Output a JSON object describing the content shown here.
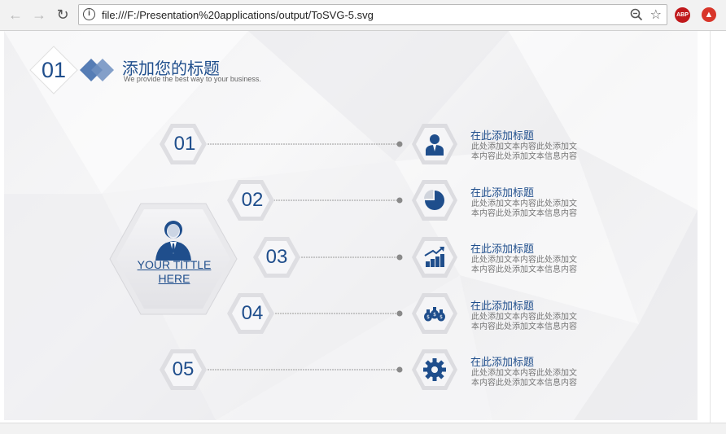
{
  "browser": {
    "url": "file:///F:/Presentation%20applications/output/ToSVG-5.svg",
    "extensions": {
      "abp_label": "ABP"
    }
  },
  "header": {
    "number": "01",
    "title": "添加您的标题",
    "subtitle": "We provide the best way to  your business."
  },
  "center": {
    "title_line1": "YOUR TITTLE ",
    "title_line2": "HERE"
  },
  "numbers": [
    "01",
    "02",
    "03",
    "04",
    "05"
  ],
  "items": [
    {
      "title": "在此添加标题",
      "desc_line1": "此处添加文本内容此处添加文",
      "desc_line2": "本内容此处添加文本信息内容",
      "icon": "person-icon"
    },
    {
      "title": "在此添加标题",
      "desc_line1": "此处添加文本内容此处添加文",
      "desc_line2": "本内容此处添加文本信息内容",
      "icon": "pie-chart-icon"
    },
    {
      "title": "在此添加标题",
      "desc_line1": "此处添加文本内容此处添加文",
      "desc_line2": "本内容此处添加文本信息内容",
      "icon": "bar-growth-icon"
    },
    {
      "title": "在此添加标题",
      "desc_line1": "此处添加文本内容此处添加文",
      "desc_line2": "本内容此处添加文本信息内容",
      "icon": "money-bags-icon"
    },
    {
      "title": "在此添加标题",
      "desc_line1": "此处添加文本内容此处添加文",
      "desc_line2": "本内容此处添加文本信息内容",
      "icon": "gear-icon"
    }
  ],
  "colors": {
    "accent": "#1f4e8c",
    "text_muted": "#777777"
  }
}
